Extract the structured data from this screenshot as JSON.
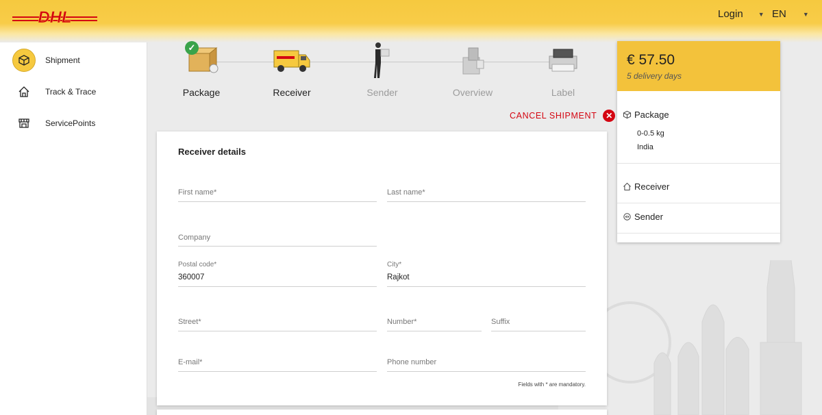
{
  "header": {
    "brand": "DHL",
    "login_label": "Login",
    "language": "EN",
    "colors": {
      "brand_yellow": "#f6c93f",
      "brand_red": "#d40511"
    }
  },
  "sidebar": {
    "items": [
      {
        "label": "Shipment",
        "icon": "package-icon",
        "active": true
      },
      {
        "label": "Track & Trace",
        "icon": "home-icon",
        "active": false
      },
      {
        "label": "ServicePoints",
        "icon": "store-icon",
        "active": false
      }
    ]
  },
  "stepper": {
    "steps": [
      {
        "label": "Package",
        "state": "completed"
      },
      {
        "label": "Receiver",
        "state": "current"
      },
      {
        "label": "Sender",
        "state": "upcoming"
      },
      {
        "label": "Overview",
        "state": "upcoming"
      },
      {
        "label": "Label",
        "state": "upcoming"
      }
    ]
  },
  "cancel_label": "CANCEL SHIPMENT",
  "form": {
    "title": "Receiver details",
    "fields": {
      "first_name": {
        "label": "First name*",
        "value": ""
      },
      "last_name": {
        "label": "Last name*",
        "value": ""
      },
      "company": {
        "label": "Company",
        "value": ""
      },
      "postal_code": {
        "label": "Postal code*",
        "value": "360007"
      },
      "city": {
        "label": "City*",
        "value": "Rajkot"
      },
      "street": {
        "label": "Street*",
        "value": ""
      },
      "number": {
        "label": "Number*",
        "value": ""
      },
      "suffix": {
        "label": "Suffix",
        "value": ""
      },
      "email": {
        "label": "E-mail*",
        "value": ""
      },
      "phone": {
        "label": "Phone number",
        "value": ""
      }
    },
    "mandatory_note": "Fields with * are mandatory."
  },
  "summary": {
    "price": "€ 57.50",
    "delivery": "5 delivery days",
    "package": {
      "title": "Package",
      "weight": "0-0.5 kg",
      "destination": "India"
    },
    "receiver": {
      "title": "Receiver"
    },
    "sender": {
      "title": "Sender"
    }
  }
}
